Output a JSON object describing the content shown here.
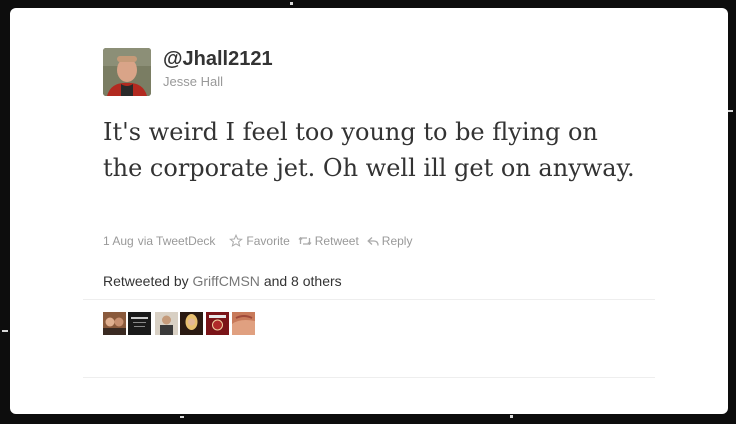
{
  "user": {
    "screen_name": "@Jhall2121",
    "full_name": "Jesse Hall"
  },
  "tweet": {
    "text": "It's weird I feel too young to be flying on the corporate jet. Oh well ill get on anyway."
  },
  "meta": {
    "date": "1 Aug",
    "via_label": "via",
    "client": "TweetDeck"
  },
  "actions": {
    "favorite": "Favorite",
    "retweet": "Retweet",
    "reply": "Reply"
  },
  "retweets": {
    "prefix": "Retweeted by",
    "user": "GriffCMSN",
    "suffix": "and 8 others"
  },
  "icons": {
    "favorite": "star-icon",
    "retweet": "retweet-icon",
    "reply": "reply-icon"
  },
  "colors": {
    "text": "#333333",
    "muted": "#999999",
    "link": "#777777",
    "background": "#0d0d0d"
  }
}
